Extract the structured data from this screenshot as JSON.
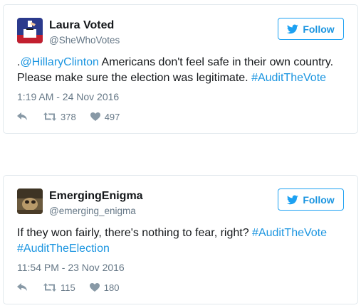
{
  "tweets": [
    {
      "name": "Laura Voted",
      "handle": "@SheWhoVotes",
      "follow_label": "Follow",
      "text_parts": [
        {
          "text": ".",
          "link": false
        },
        {
          "text": "@HillaryClinton",
          "link": true
        },
        {
          "text": " Americans don't feel safe in their own country. Please make sure the election was legitimate. ",
          "link": false
        },
        {
          "text": "#AuditTheVote",
          "link": true
        }
      ],
      "timestamp": "1:19 AM - 24 Nov 2016",
      "retweets": "378",
      "likes": "497",
      "avatar_icon": "ballot-box-avatar"
    },
    {
      "name": "EmergingEnigma",
      "handle": "@emerging_enigma",
      "follow_label": "Follow",
      "text_parts": [
        {
          "text": "If they won fairly, there's nothing to fear, right? ",
          "link": false
        },
        {
          "text": "#AuditTheVote",
          "link": true
        },
        {
          "text": " ",
          "link": false
        },
        {
          "text": "#AuditTheElection",
          "link": true
        }
      ],
      "timestamp": "11:54 PM - 23 Nov 2016",
      "retweets": "115",
      "likes": "180",
      "avatar_icon": "photo-avatar"
    }
  ],
  "colors": {
    "link": "#1b95e0",
    "follow_border": "#1da1f2",
    "muted": "#657786",
    "border": "#e1e8ed"
  },
  "icons": {
    "follow": "twitter-bird-icon",
    "reply": "reply-icon",
    "retweet": "retweet-icon",
    "like": "heart-icon"
  }
}
